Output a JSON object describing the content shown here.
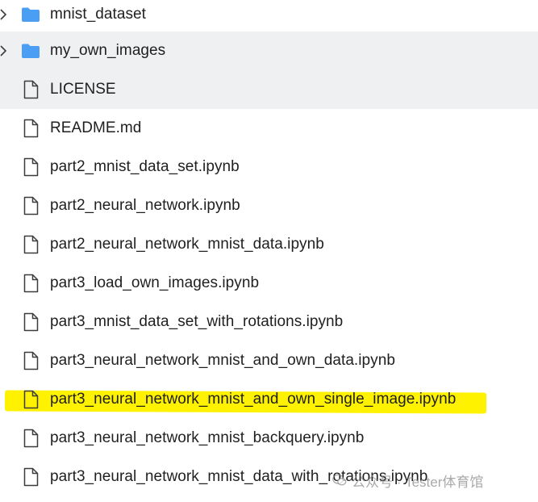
{
  "colors": {
    "folder": "#4a9ff5",
    "file_outline": "#3c3c3c",
    "hover_row": "#f0f1f3",
    "highlight": "#fff200",
    "text": "#1f1f1f"
  },
  "files": [
    {
      "name": "mnist_dataset",
      "kind": "folder",
      "icon": "folder-icon"
    },
    {
      "name": "my_own_images",
      "kind": "folder",
      "icon": "folder-icon"
    },
    {
      "name": "LICENSE",
      "kind": "file",
      "icon": "file-icon"
    },
    {
      "name": "README.md",
      "kind": "file",
      "icon": "file-icon"
    },
    {
      "name": "part2_mnist_data_set.ipynb",
      "kind": "file",
      "icon": "file-icon"
    },
    {
      "name": "part2_neural_network.ipynb",
      "kind": "file",
      "icon": "file-icon"
    },
    {
      "name": "part2_neural_network_mnist_data.ipynb",
      "kind": "file",
      "icon": "file-icon"
    },
    {
      "name": "part3_load_own_images.ipynb",
      "kind": "file",
      "icon": "file-icon"
    },
    {
      "name": "part3_mnist_data_set_with_rotations.ipynb",
      "kind": "file",
      "icon": "file-icon"
    },
    {
      "name": "part3_neural_network_mnist_and_own_data.ipynb",
      "kind": "file",
      "icon": "file-icon"
    },
    {
      "name": "part3_neural_network_mnist_and_own_single_image.ipynb",
      "kind": "file",
      "icon": "file-icon"
    },
    {
      "name": "part3_neural_network_mnist_backquery.ipynb",
      "kind": "file",
      "icon": "file-icon"
    },
    {
      "name": "part3_neural_network_mnist_data_with_rotations.ipynb",
      "kind": "file",
      "icon": "file-icon"
    }
  ],
  "watermark": {
    "text": "公众号 · Tester体育馆"
  }
}
